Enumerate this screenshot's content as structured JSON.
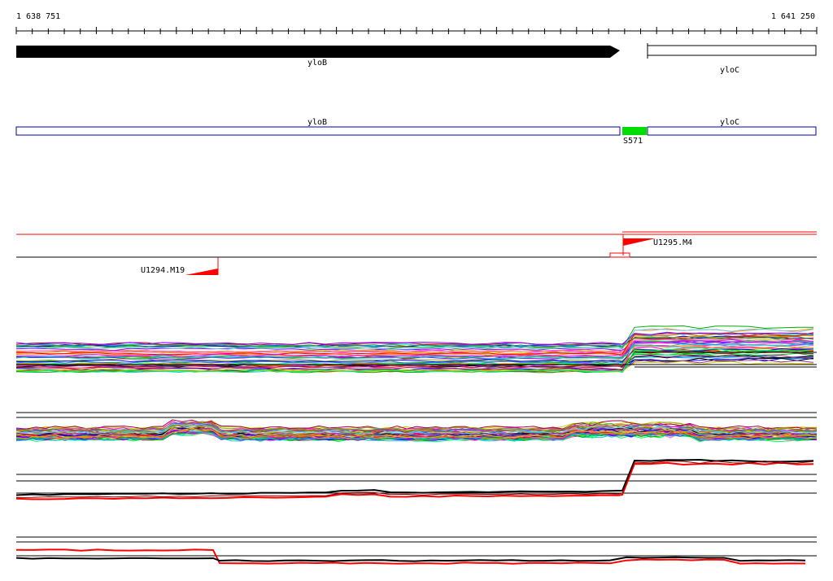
{
  "coordinate_axis": {
    "start_label": "1 638 751",
    "end_label": "1 641 250",
    "start": 1638751,
    "end": 1641250
  },
  "annotated_genes": [
    {
      "name": "yloB",
      "strand": "+"
    },
    {
      "name": "yloC",
      "strand": "+"
    }
  ],
  "segment_track": {
    "segments": [
      {
        "label": "yloB",
        "type": "gene"
      },
      {
        "label": "S571",
        "type": "region",
        "color": "#00dd00"
      },
      {
        "label": "yloC",
        "type": "gene"
      }
    ]
  },
  "transcription_units": [
    {
      "label": "U1295.M4",
      "color": "#ff0000"
    },
    {
      "label": "U1294.M19",
      "color": "#ff0000"
    }
  ],
  "colors": {
    "gene_outline": "#0000aa",
    "s571_fill": "#00dd00",
    "upshift_red": "#ff0000",
    "black": "#000000"
  }
}
